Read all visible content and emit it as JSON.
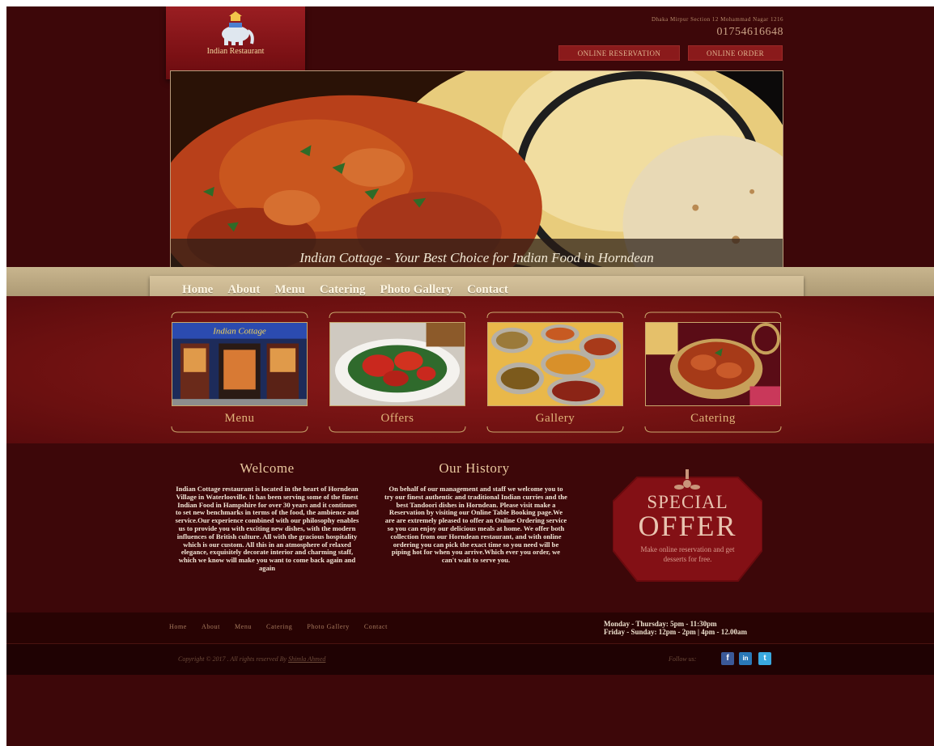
{
  "brand": {
    "name": "Indian Restaurant"
  },
  "contact": {
    "address": "Dhaka Mirpur Section 12 Mohammad Nagar 1216",
    "phone": "01754616648"
  },
  "top_buttons": {
    "reservation": "ONLINE RESERVATION",
    "order": "ONLINE ORDER"
  },
  "hero": {
    "caption": "Indian Cottage - Your Best Choice for Indian Food in Horndean"
  },
  "nav": {
    "items": [
      "Home",
      "About",
      "Menu",
      "Catering",
      "Photo Gallery",
      "Contact"
    ]
  },
  "features": [
    {
      "label": "Menu"
    },
    {
      "label": "Offers"
    },
    {
      "label": "Gallery"
    },
    {
      "label": "Catering"
    }
  ],
  "storefront_sign": "Indian Cottage",
  "welcome": {
    "title": "Welcome",
    "text": "Indian Cottage restaurant is located in the heart of Horndean Village in Waterlooville. It has been serving some of the finest Indian Food in Hampshire for over 30 years and it continues to set new benchmarks in terms of the food, the ambience and service.Our experience combined with our philosophy enables us to provide you with exciting new dishes, with the modern influences of British culture. All with the gracious hospitality which is our custom. All this in an atmosphere of relaxed elegance, exquisitely decorate interior and charming staff, which we know will make you want to come back again and again"
  },
  "history": {
    "title": "Our History",
    "text": "On behalf of our management and staff we welcome you to try our finest authentic and traditional Indian curries and the best Tandoori dishes in Horndean. Please visit make a Reservation by visiting our Online Table Booking page.We are are extremely pleased to offer an Online Ordering service so you can enjoy our delicious meals at home. We offer both collection from our Horndean restaurant, and with online ordering you can pick the exact time so you need will be piping hot for when you arrive.Which ever you order, we can't wait to serve you."
  },
  "special_offer": {
    "line1": "SPECIAL",
    "line2": "OFFER",
    "text": "Make online reservation and get desserts for free."
  },
  "footer": {
    "links": [
      "Home",
      "About",
      "Menu",
      "Catering",
      "Photo Gallery",
      "Contact"
    ],
    "hours_1": "Monday - Thursday: 5pm - 11:30pm",
    "hours_2": "Friday - Sunday: 12pm - 2pm | 4pm - 12.00am",
    "copyright": "Copyright © 2017 . All rights reserved By",
    "author": "Shimla Ahmed",
    "follow": "Follow us:"
  },
  "social": [
    "facebook-icon",
    "linkedin-icon",
    "twitter-icon"
  ],
  "colors": {
    "page_bg": "#3d0709",
    "red_band": "#8e1a1a",
    "nav_beige": "#d6c39c",
    "gold_text": "#e0b57a"
  }
}
